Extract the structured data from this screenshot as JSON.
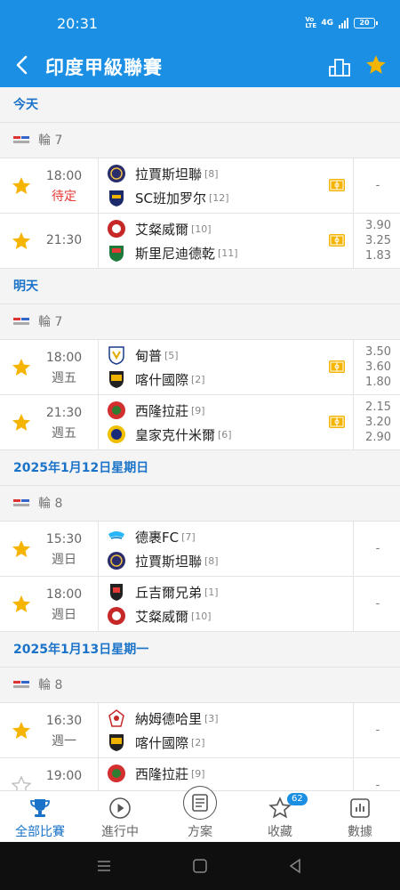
{
  "status": {
    "time": "20:31",
    "volte": "Vo LTE",
    "net": "4G",
    "battery": "20"
  },
  "appbar": {
    "title": "印度甲級聯賽"
  },
  "sections": {
    "today": {
      "label": "今天",
      "round": "輪 7"
    },
    "tomorrow": {
      "label": "明天",
      "round": "輪 7"
    },
    "jan12": {
      "label": "2025年1月12日星期日",
      "round": "輪 8"
    },
    "jan13": {
      "label": "2025年1月13日星期一",
      "round": "輪 8"
    }
  },
  "matches": [
    {
      "time": "18:00",
      "sub": "待定",
      "home": "拉賈斯坦聯",
      "home_rank": "[8]",
      "away": "SC班加罗尔",
      "away_rank": "[12]",
      "odds": [
        "-"
      ],
      "starred": true
    },
    {
      "time": "21:30",
      "sub": "",
      "home": "艾粲威爾",
      "home_rank": "[10]",
      "away": "斯里尼迪德乾",
      "away_rank": "[11]",
      "odds": [
        "3.90",
        "3.25",
        "1.83"
      ],
      "starred": true
    },
    {
      "time": "18:00",
      "sub": "週五",
      "home": "甸普",
      "home_rank": "[5]",
      "away": "喀什國際",
      "away_rank": "[2]",
      "odds": [
        "3.50",
        "3.60",
        "1.80"
      ],
      "starred": true
    },
    {
      "time": "21:30",
      "sub": "週五",
      "home": "西隆拉莊",
      "home_rank": "[9]",
      "away": "皇家克什米爾",
      "away_rank": "[6]",
      "odds": [
        "2.15",
        "3.20",
        "2.90"
      ],
      "starred": true
    },
    {
      "time": "15:30",
      "sub": "週日",
      "home": "德裹FC",
      "home_rank": "[7]",
      "away": "拉賈斯坦聯",
      "away_rank": "[8]",
      "odds": [
        "-"
      ],
      "starred": true
    },
    {
      "time": "18:00",
      "sub": "週日",
      "home": "丘吉爾兄弟",
      "home_rank": "[1]",
      "away": "艾粲威爾",
      "away_rank": "[10]",
      "odds": [
        "-"
      ],
      "starred": true
    },
    {
      "time": "16:30",
      "sub": "週一",
      "home": "納姆德哈里",
      "home_rank": "[3]",
      "away": "喀什國際",
      "away_rank": "[2]",
      "odds": [
        "-"
      ],
      "starred": true
    },
    {
      "time": "19:00",
      "sub": "",
      "home": "西隆拉莊",
      "home_rank": "[9]",
      "away": "",
      "away_rank": "",
      "odds": [
        "-"
      ],
      "starred": false
    }
  ],
  "nav": {
    "all": "全部比賽",
    "live": "進行中",
    "plan": "方案",
    "fav": "收藏",
    "fav_badge": "62",
    "data": "數據"
  },
  "colors": {
    "primary": "#1a8fe3",
    "star": "#f5b400",
    "live": "#f5b400",
    "link": "#1a73c8"
  }
}
